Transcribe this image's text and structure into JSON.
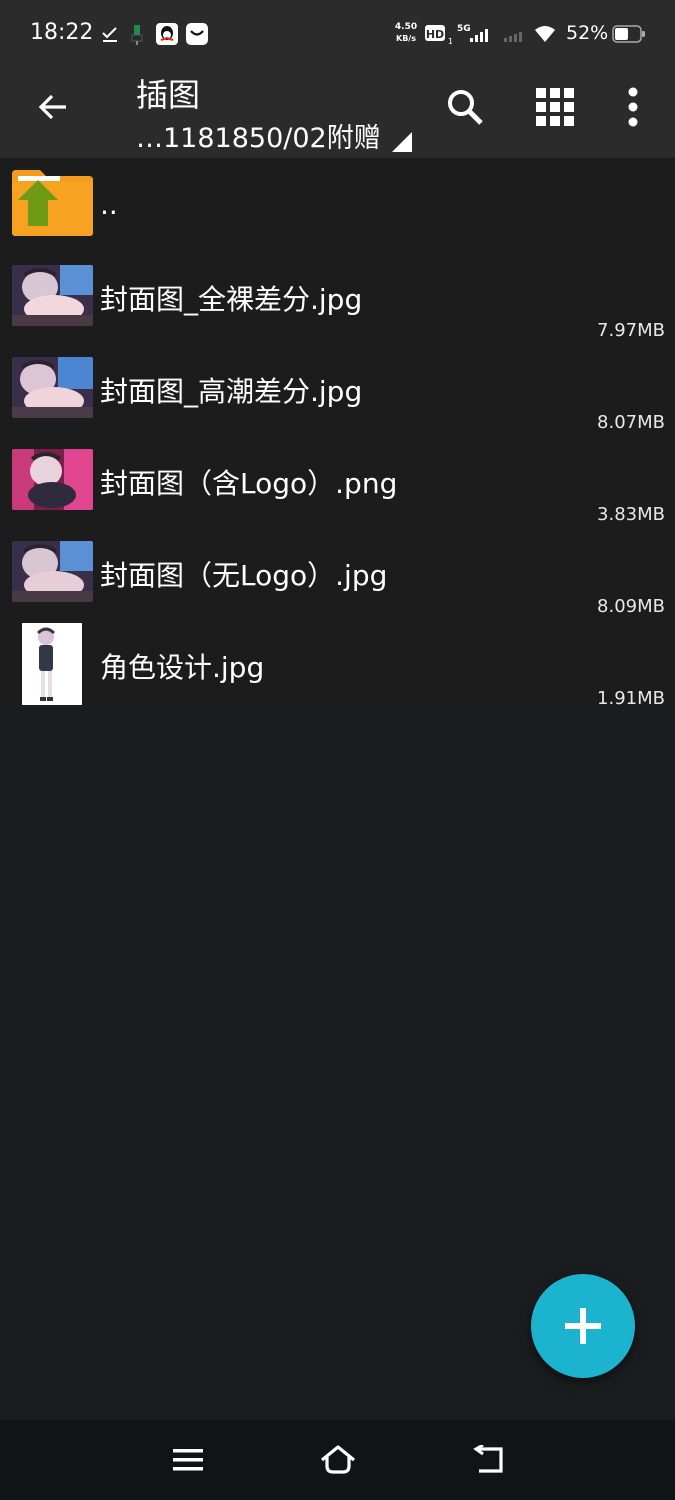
{
  "status_bar": {
    "time": "18:22",
    "net_speed_value": "4.50",
    "net_speed_unit": "KB/s",
    "hd_label": "HD",
    "network_label": "5G",
    "battery": "52%",
    "icons": [
      "check-icon",
      "usb-icon",
      "qq-icon",
      "mail-icon",
      "hd-icon",
      "signal-5g-icon",
      "signal-icon",
      "wifi-icon",
      "battery-icon"
    ]
  },
  "app_bar": {
    "title": "插图",
    "path": "…1181850/02附赠",
    "icons": [
      "back-arrow-icon",
      "dropdown-triangle-icon",
      "search-icon",
      "grid-view-icon",
      "more-vert-icon"
    ]
  },
  "files": [
    {
      "name": "..",
      "size": "",
      "thumb": "parent-folder-icon"
    },
    {
      "name": "封面图_全裸差分.jpg",
      "size": "7.97MB",
      "thumb": "image-thumbnail"
    },
    {
      "name": "封面图_高潮差分.jpg",
      "size": "8.07MB",
      "thumb": "image-thumbnail"
    },
    {
      "name": "封面图（含Logo）.png",
      "size": "3.83MB",
      "thumb": "image-thumbnail"
    },
    {
      "name": "封面图（无Logo）.jpg",
      "size": "8.09MB",
      "thumb": "image-thumbnail"
    },
    {
      "name": "角色设计.jpg",
      "size": "1.91MB",
      "thumb": "image-thumbnail"
    }
  ],
  "fab": {
    "icon": "plus-icon"
  },
  "nav_bar": {
    "icons": [
      "menu-icon",
      "home-icon",
      "back-icon"
    ]
  },
  "colors": {
    "app_bar": "#2b2b2b",
    "list_bg": "#1c1c1c",
    "page_bg": "#1a1d20",
    "fab": "#1cb3cf",
    "folder": "#f39c1f",
    "folder_arrow": "#6f9a16"
  }
}
